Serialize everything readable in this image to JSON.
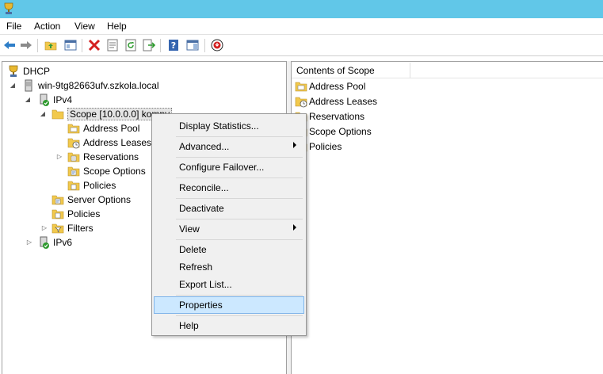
{
  "menu": [
    "File",
    "Action",
    "View",
    "Help"
  ],
  "toolbar": {
    "icons": [
      "back-icon",
      "forward-icon",
      "up-folder-icon",
      "show-hide-console-tree-icon",
      "delete-icon",
      "properties-icon",
      "refresh-icon",
      "export-list-icon",
      "help-icon",
      "action-pane-icon",
      "stop-service-icon"
    ]
  },
  "tree": {
    "root": "DHCP",
    "server": "win-9tg82663ufv.szkola.local",
    "ipv4": "IPv4",
    "scope": "Scope [10.0.0.0] kompy",
    "scope_children": [
      "Address Pool",
      "Address Leases",
      "Reservations",
      "Scope Options",
      "Policies"
    ],
    "ipv4_children": [
      "Server Options",
      "Policies",
      "Filters"
    ],
    "ipv6": "IPv6"
  },
  "right_pane": {
    "column_header": "Contents of Scope",
    "items": [
      "Address Pool",
      "Address Leases",
      "Reservations",
      "Scope Options",
      "Policies"
    ]
  },
  "context_menu": {
    "items": [
      {
        "label": "Display Statistics..."
      },
      {
        "label": "Advanced..."
      },
      {
        "label": "Configure Failover..."
      },
      {
        "label": "Reconcile..."
      },
      {
        "label": "Deactivate"
      },
      {
        "label": "View"
      },
      {
        "label": "Delete"
      },
      {
        "label": "Refresh"
      },
      {
        "label": "Export List..."
      },
      {
        "label": "Properties"
      },
      {
        "label": "Help"
      }
    ],
    "highlighted": "Properties"
  },
  "colors": {
    "titlebar": "#61c7e8",
    "menu_highlight": "#cce8ff",
    "folder": "#f2c94c"
  }
}
